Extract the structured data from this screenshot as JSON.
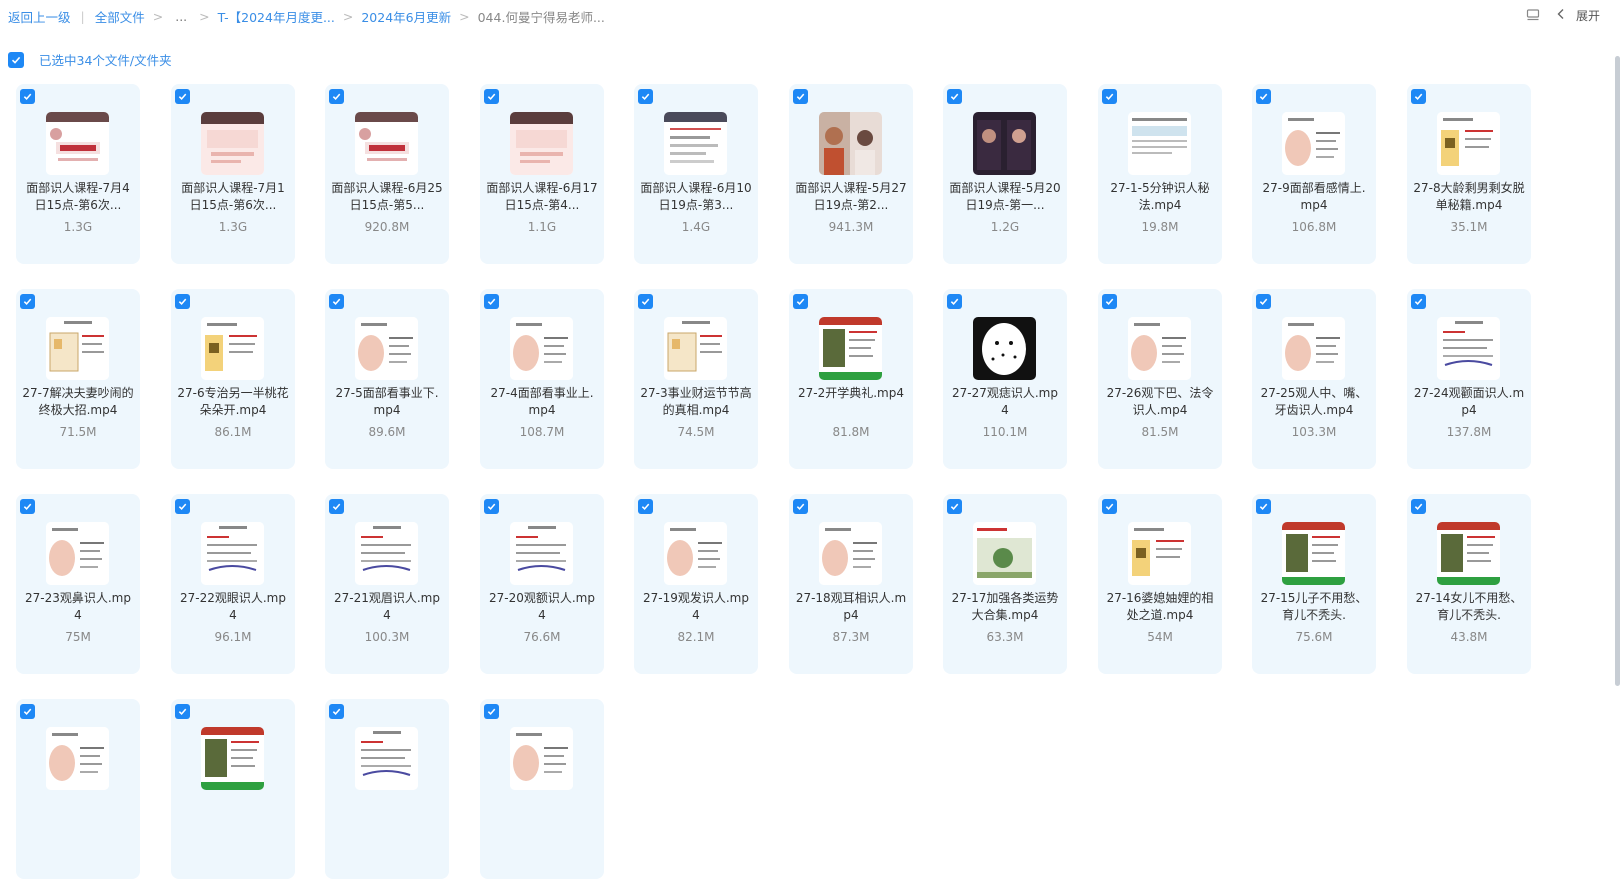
{
  "breadcrumb": {
    "back": "返回上一级",
    "all_files": "全部文件",
    "ellipsis": "...",
    "folder1": "T-【2024年月度更...",
    "folder2": "2024年6月更新",
    "current": "044.何曼宁得易老师..."
  },
  "toolbar": {
    "expand_label": "展开"
  },
  "selection": {
    "label": "已选中34个文件/文件夹"
  },
  "colors": {
    "accent": "#1e88f5",
    "card_bg": "#eef7fd",
    "link": "#3a8ee6"
  },
  "files": [
    {
      "name": "面部识人课程-7月4日15点-第6次...",
      "size": "1.3G",
      "thumb": "poster"
    },
    {
      "name": "面部识人课程-7月1日15点-第6次...",
      "size": "1.3G",
      "thumb": "poster-pink"
    },
    {
      "name": "面部识人课程-6月25日15点-第5...",
      "size": "920.8M",
      "thumb": "poster"
    },
    {
      "name": "面部识人课程-6月17日15点-第4...",
      "size": "1.1G",
      "thumb": "poster-pink"
    },
    {
      "name": "面部识人课程-6月10日19点-第3...",
      "size": "1.4G",
      "thumb": "poster-white"
    },
    {
      "name": "面部识人课程-5月27日19点-第2...",
      "size": "941.3M",
      "thumb": "video"
    },
    {
      "name": "面部识人课程-5月20日19点-第一...",
      "size": "1.2G",
      "thumb": "video-dark"
    },
    {
      "name": "27-1-5分钟识人秘法.mp4",
      "size": "19.8M",
      "thumb": "slide-blue"
    },
    {
      "name": "27-9面部看感情上.mp4",
      "size": "106.8M",
      "thumb": "slide-face"
    },
    {
      "name": "27-8大龄剩男剩女脱单秘籍.mp4",
      "size": "35.1M",
      "thumb": "slide-yellow"
    },
    {
      "name": "27-7解决夫妻吵闹的终极大招.mp4",
      "size": "71.5M",
      "thumb": "slide-plan"
    },
    {
      "name": "27-6专治另一半桃花朵朵开.mp4",
      "size": "86.1M",
      "thumb": "slide-yellow"
    },
    {
      "name": "27-5面部看事业下.mp4",
      "size": "89.6M",
      "thumb": "slide-face"
    },
    {
      "name": "27-4面部看事业上.mp4",
      "size": "108.7M",
      "thumb": "slide-face"
    },
    {
      "name": "27-3事业财运节节高的真相.mp4",
      "size": "74.5M",
      "thumb": "slide-plan"
    },
    {
      "name": "27-2开学典礼.mp4",
      "size": "81.8M",
      "thumb": "slide-red"
    },
    {
      "name": "27-27观痣识人.mp4",
      "size": "110.1M",
      "thumb": "slide-map"
    },
    {
      "name": "27-26观下巴、法令识人.mp4",
      "size": "81.5M",
      "thumb": "slide-face"
    },
    {
      "name": "27-25观人中、嘴、牙齿识人.mp4",
      "size": "103.3M",
      "thumb": "slide-face"
    },
    {
      "name": "27-24观颧面识人.mp4",
      "size": "137.8M",
      "thumb": "slide-text"
    },
    {
      "name": "27-23观鼻识人.mp4",
      "size": "75M",
      "thumb": "slide-face"
    },
    {
      "name": "27-22观眼识人.mp4",
      "size": "96.1M",
      "thumb": "slide-text"
    },
    {
      "name": "27-21观眉识人.mp4",
      "size": "100.3M",
      "thumb": "slide-text"
    },
    {
      "name": "27-20观额识人.mp4",
      "size": "76.6M",
      "thumb": "slide-text"
    },
    {
      "name": "27-19观发识人.mp4",
      "size": "82.1M",
      "thumb": "slide-face"
    },
    {
      "name": "27-18观耳相识人.mp4",
      "size": "87.3M",
      "thumb": "slide-face"
    },
    {
      "name": "27-17加强各类运势大合集.mp4",
      "size": "63.3M",
      "thumb": "slide-green"
    },
    {
      "name": "27-16婆媳妯娌的相处之道.mp4",
      "size": "54M",
      "thumb": "slide-yellow"
    },
    {
      "name": "27-15儿子不用愁、育儿不秃头.",
      "size": "75.6M",
      "thumb": "slide-red"
    },
    {
      "name": "27-14女儿不用愁、育儿不秃头.",
      "size": "43.8M",
      "thumb": "slide-red"
    },
    {
      "name": "",
      "size": "",
      "thumb": "slide-face"
    },
    {
      "name": "",
      "size": "",
      "thumb": "slide-red"
    },
    {
      "name": "",
      "size": "",
      "thumb": "slide-text"
    },
    {
      "name": "",
      "size": "",
      "thumb": "slide-face"
    }
  ]
}
